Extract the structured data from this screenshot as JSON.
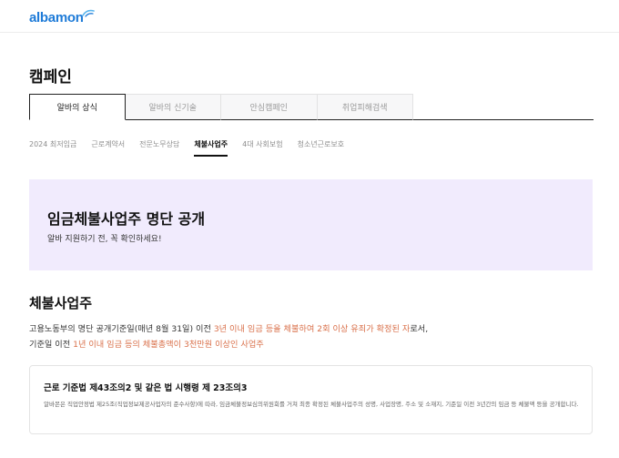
{
  "header": {
    "logo_text": "albamon"
  },
  "page": {
    "title": "캠페인"
  },
  "main_tabs": [
    {
      "label": "알바의 상식",
      "active": true
    },
    {
      "label": "알바의 신기술",
      "active": false
    },
    {
      "label": "안심캠페인",
      "active": false
    },
    {
      "label": "취업피해검색",
      "active": false
    }
  ],
  "sub_tabs": [
    {
      "label": "2024 최저임금",
      "active": false
    },
    {
      "label": "근로계약서",
      "active": false
    },
    {
      "label": "전문노무상담",
      "active": false
    },
    {
      "label": "체불사업주",
      "active": true
    },
    {
      "label": "4대 사회보험",
      "active": false
    },
    {
      "label": "청소년근로보호",
      "active": false
    }
  ],
  "banner": {
    "title": "임금체불사업주 명단 공개",
    "subtitle": "알바 지원하기 전, 꼭 확인하세요!",
    "background": "#f1ebfd"
  },
  "section": {
    "title": "체불사업주",
    "line1": {
      "prefix": "고용노동부의 명단 공개기준일(매년 8월 31일) 이전 ",
      "highlight": "3년 이내 임금 등을 체불하여 2회 이상 유죄가 확정된 자",
      "suffix": "로서,"
    },
    "line2": {
      "prefix": "기준일 이전 ",
      "highlight": "1년 이내 임금 등의 체불총액이 3천만원 이상인 사업주"
    }
  },
  "law": {
    "title": "근로 기준법 제43조의2 및 같은 법 시행령 제 23조의3",
    "text": "알바몬은 직업안정법 제25조(직업정보제공사업자의 준수사항)에 따라, 임금체불정보심의위원회를 거쳐 최종 확정된 체불사업주의 성명, 사업장명, 주소 및 소재지, 기준일 이전 3년간의 임금 등 체불액 등을 공개합니다."
  },
  "colors": {
    "accent": "#d9704a",
    "logo": "#1e7bd8"
  }
}
